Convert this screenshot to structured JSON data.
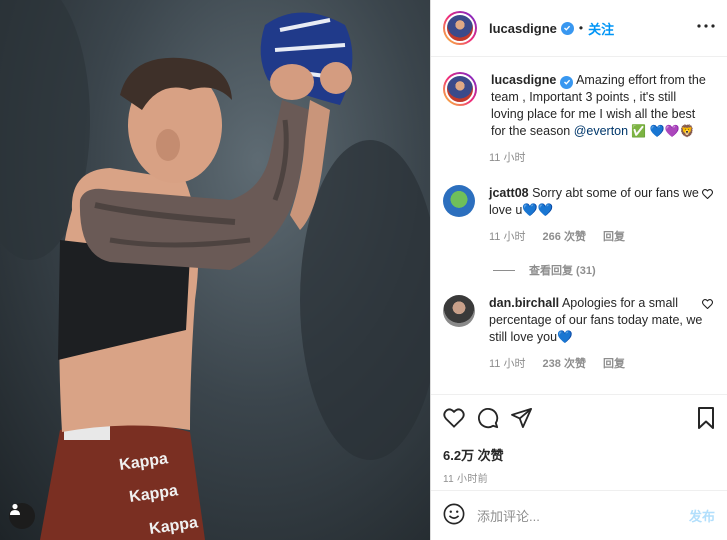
{
  "post": {
    "author": "lucasdigne",
    "follow_label": "关注",
    "dot": "•",
    "caption_user": "lucasdigne",
    "caption_text": "Amazing effort from the team , Important 3 points , it's still loving place for me I wish all the best for the season ",
    "caption_mention": "@everton",
    "caption_emoji": " ✅ 💙💜🦁",
    "caption_time": "11 小时",
    "likes": "6.2万 次赞",
    "posted_ago": "11 小时前",
    "photo_brand": "Kappa"
  },
  "comments": [
    {
      "user": "jcatt08",
      "text": "Sorry abt some of our fans we love u💙💙",
      "time": "11 小时",
      "likes": "266 次赞",
      "reply": "回复",
      "view_replies": "查看回复 (31)"
    },
    {
      "user": "dan.birchall",
      "text": "Apologies for a small percentage of our fans today mate, we still love you💙",
      "time": "11 小时",
      "likes": "238 次赞",
      "reply": "回复"
    }
  ],
  "composer": {
    "placeholder": "添加评论...",
    "post_label": "发布"
  },
  "icons": {
    "verified": "verified-badge-icon",
    "more": "more-options-icon",
    "like": "heart-icon",
    "comment": "comment-bubble-icon",
    "share": "paper-plane-icon",
    "save": "bookmark-icon",
    "emoji": "smiley-icon",
    "tag": "user-tag-icon"
  },
  "colors": {
    "accent": "#0095f6",
    "verified": "#3897f0",
    "muted": "#8e8e8e",
    "post_disabled": "#b2dffc"
  }
}
